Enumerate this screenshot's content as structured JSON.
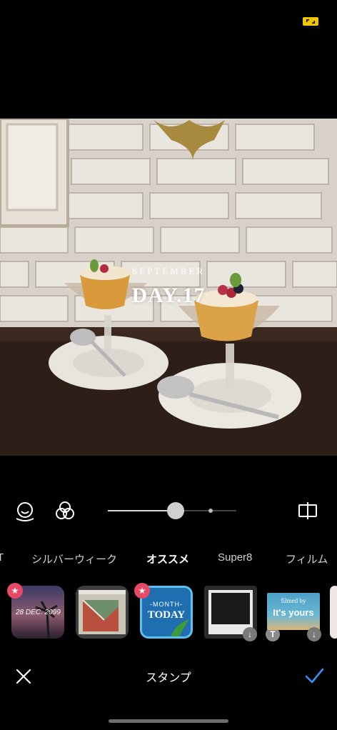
{
  "status": {
    "icon": "aspect-ratio-icon",
    "accent": "#f5c400"
  },
  "photo": {
    "overlay_month": "SEPTEMBER",
    "overlay_day": "DAY.17"
  },
  "tools": {
    "face_icon": "face-retouch-icon",
    "filter_icon": "filter-circles-icon",
    "compare_icon": "compare-split-icon",
    "slider_value": 0.53
  },
  "tabs": [
    {
      "label": "T"
    },
    {
      "label": "シルバーウィーク"
    },
    {
      "label": "オススメ"
    },
    {
      "label": "Super8"
    },
    {
      "label": "フィルム"
    }
  ],
  "active_tab": "オススメ",
  "stickers": [
    {
      "text": "28 DEC. 2099",
      "badge": "star"
    },
    {
      "text": "",
      "badge": "none"
    },
    {
      "line1": "-MONTH-",
      "line2": "TODAY",
      "badge": "star"
    },
    {
      "text": "",
      "badge": "download"
    },
    {
      "line1": "filmed by",
      "line2": "It's yours",
      "badge": "download"
    }
  ],
  "bottom": {
    "title": "スタンプ",
    "confirm_color": "#3a8ef6"
  }
}
